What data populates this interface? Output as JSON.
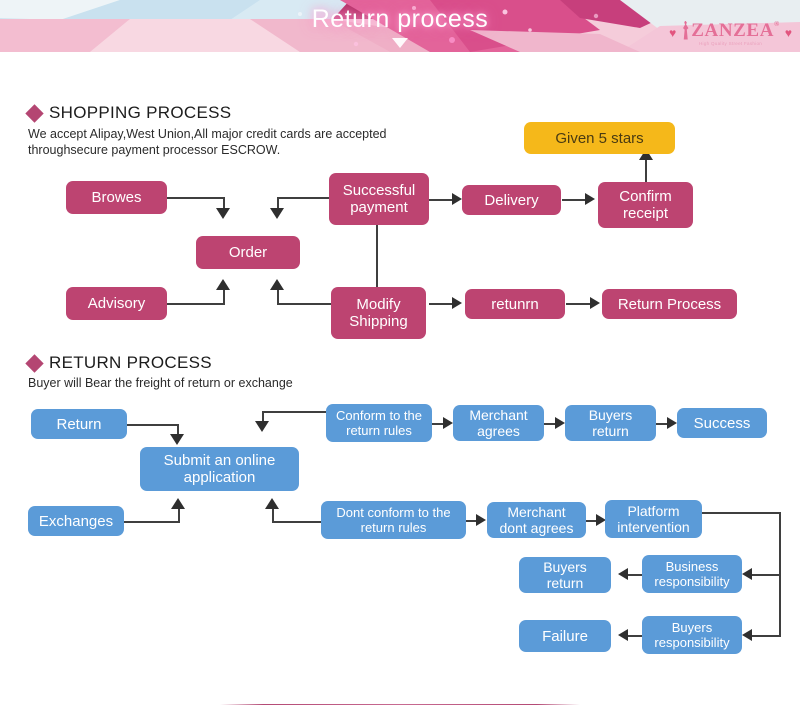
{
  "banner": {
    "title": "Return process",
    "brand": {
      "name": "ZANZEA",
      "registered": "®",
      "tagline": "High Quality Street Fashion",
      "heart_left": "♥",
      "heart_right": "♥"
    }
  },
  "shopping": {
    "heading": "SHOPPING PROCESS",
    "description_line1": "We accept Alipay,West Union,All major credit cards are accepted",
    "description_line2": "throughsecure payment processor ESCROW.",
    "nodes": {
      "browes": "Browes",
      "order": "Order",
      "advisory": "Advisory",
      "successful_payment": "Successful payment",
      "modify_shipping": "Modify Shipping",
      "delivery": "Delivery",
      "confirm_receipt": "Confirm receipt",
      "given_5_stars": "Given 5 stars",
      "retunrn": "retunrn",
      "return_process": "Return Process"
    }
  },
  "returns": {
    "heading": "RETURN PROCESS",
    "description": "Buyer will Bear the freight of return or exchange",
    "nodes": {
      "return": "Return",
      "exchanges": "Exchanges",
      "submit_application": "Submit an online application",
      "conform_rules": "Conform to the return rules",
      "merchant_agrees": "Merchant agrees",
      "buyers_return_top": "Buyers return",
      "success": "Success",
      "dont_conform_rules": "Dont conform to the return rules",
      "merchant_dont_agrees": "Merchant dont agrees",
      "platform_intervention": "Platform intervention",
      "business_responsibility": "Business responsibility",
      "buyers_return_bottom": "Buyers return",
      "buyers_responsibility": "Buyers responsibility",
      "failure": "Failure"
    }
  },
  "colors": {
    "pink": "#bd4471",
    "blue": "#5b9bd8",
    "yellow": "#f5b81a",
    "accent_diamond": "#b44672",
    "connector": "#3f3f3f"
  }
}
